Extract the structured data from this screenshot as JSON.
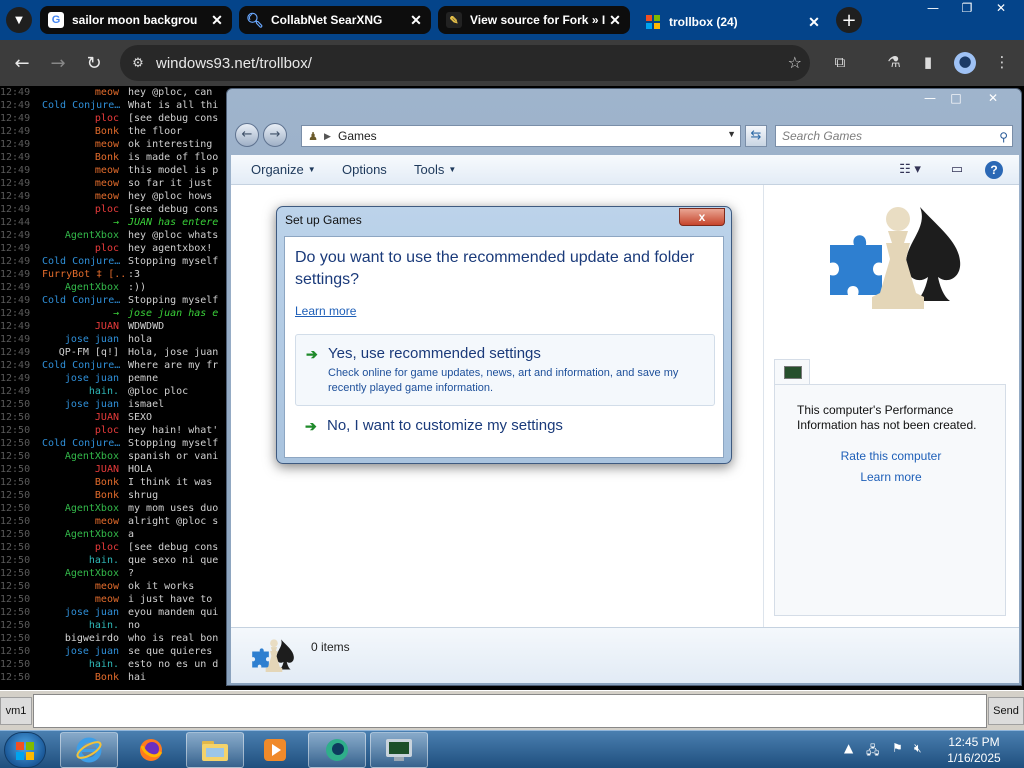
{
  "browser": {
    "tabs": [
      {
        "title": "sailor moon backgrou",
        "favicon": "google-icon"
      },
      {
        "title": "CollabNet SearXNG",
        "favicon": "search-icon"
      },
      {
        "title": "View source for Fork » I",
        "favicon": "wiki-icon"
      },
      {
        "title": "trollbox (24)",
        "favicon": "windows-flag-icon",
        "active": true
      }
    ],
    "url": "windows93.net/trollbox/"
  },
  "chat": {
    "messages": [
      {
        "time": "12:49",
        "nick": "meow",
        "color": "#e36c2c",
        "text": "hey @ploc, can"
      },
      {
        "time": "12:49",
        "nick": "Cold Conjure…",
        "color": "#2f8fd8",
        "text": "What is all thi"
      },
      {
        "time": "12:49",
        "nick": "ploc",
        "color": "#e83b3b",
        "text": "[see debug cons"
      },
      {
        "time": "12:49",
        "nick": "Bonk",
        "color": "#e36c2c",
        "text": "the floor"
      },
      {
        "time": "12:49",
        "nick": "meow",
        "color": "#e36c2c",
        "text": "ok interesting"
      },
      {
        "time": "12:49",
        "nick": "Bonk",
        "color": "#e36c2c",
        "text": "is made of floo"
      },
      {
        "time": "12:49",
        "nick": "meow",
        "color": "#e36c2c",
        "text": "this model is p"
      },
      {
        "time": "12:49",
        "nick": "meow",
        "color": "#e36c2c",
        "text": "so far it just"
      },
      {
        "time": "12:49",
        "nick": "meow",
        "color": "#e36c2c",
        "text": "hey @ploc hows"
      },
      {
        "time": "12:49",
        "nick": "ploc",
        "color": "#e83b3b",
        "text": "[see debug cons"
      },
      {
        "time": "12:44",
        "nick": "→",
        "color": "#3ad23a",
        "text": "JUAN has entere",
        "sys": true
      },
      {
        "time": "12:49",
        "nick": "AgentXbox",
        "color": "#33b84a",
        "text": "hey @ploc whats"
      },
      {
        "time": "12:49",
        "nick": "ploc",
        "color": "#e83b3b",
        "text": "hey agentxbox!"
      },
      {
        "time": "12:49",
        "nick": "Cold Conjure…",
        "color": "#2f8fd8",
        "text": "Stopping myself"
      },
      {
        "time": "12:49",
        "nick": "FurryBot ‡ [..",
        "color": "#e36c2c",
        "text": ":3"
      },
      {
        "time": "12:49",
        "nick": "AgentXbox",
        "color": "#33b84a",
        "text": ":))"
      },
      {
        "time": "12:49",
        "nick": "Cold Conjure…",
        "color": "#2f8fd8",
        "text": "Stopping myself"
      },
      {
        "time": "12:49",
        "nick": "→",
        "color": "#3ad23a",
        "text": "jose juan has e",
        "sys": true
      },
      {
        "time": "12:49",
        "nick": "JUAN",
        "color": "#e83b3b",
        "text": "WDWDWD"
      },
      {
        "time": "12:49",
        "nick": "jose juan",
        "color": "#2f8fd8",
        "text": "hola"
      },
      {
        "time": "12:49",
        "nick": "QP-FM [q!]",
        "color": "#cfcfcf",
        "text": "Hola, jose juan"
      },
      {
        "time": "12:49",
        "nick": "Cold Conjure…",
        "color": "#2f8fd8",
        "text": "Where are my fr"
      },
      {
        "time": "12:49",
        "nick": "jose juan",
        "color": "#2f8fd8",
        "text": "pemne"
      },
      {
        "time": "12:49",
        "nick": "hain.",
        "color": "#2fb8b8",
        "text": "@ploc ploc"
      },
      {
        "time": "12:50",
        "nick": "jose juan",
        "color": "#2f8fd8",
        "text": "ismael"
      },
      {
        "time": "12:50",
        "nick": "JUAN",
        "color": "#e83b3b",
        "text": "SEXO"
      },
      {
        "time": "12:50",
        "nick": "ploc",
        "color": "#e83b3b",
        "text": "hey hain! what'"
      },
      {
        "time": "12:50",
        "nick": "Cold Conjure…",
        "color": "#2f8fd8",
        "text": "Stopping myself"
      },
      {
        "time": "12:50",
        "nick": "AgentXbox",
        "color": "#33b84a",
        "text": "spanish or vani"
      },
      {
        "time": "12:50",
        "nick": "JUAN",
        "color": "#e83b3b",
        "text": "HOLA"
      },
      {
        "time": "12:50",
        "nick": "Bonk",
        "color": "#e36c2c",
        "text": "I think it was"
      },
      {
        "time": "12:50",
        "nick": "Bonk",
        "color": "#e36c2c",
        "text": "shrug"
      },
      {
        "time": "12:50",
        "nick": "AgentXbox",
        "color": "#33b84a",
        "text": "my mom uses duo"
      },
      {
        "time": "12:50",
        "nick": "meow",
        "color": "#e36c2c",
        "text": "alright @ploc s"
      },
      {
        "time": "12:50",
        "nick": "AgentXbox",
        "color": "#33b84a",
        "text": "a"
      },
      {
        "time": "12:50",
        "nick": "ploc",
        "color": "#e83b3b",
        "text": "[see debug cons"
      },
      {
        "time": "12:50",
        "nick": "hain.",
        "color": "#2fb8b8",
        "text": "que sexo ni que"
      },
      {
        "time": "12:50",
        "nick": "AgentXbox",
        "color": "#33b84a",
        "text": "?"
      },
      {
        "time": "12:50",
        "nick": "meow",
        "color": "#e36c2c",
        "text": "ok it works"
      },
      {
        "time": "12:50",
        "nick": "meow",
        "color": "#e36c2c",
        "text": "i just have to"
      },
      {
        "time": "12:50",
        "nick": "jose juan",
        "color": "#2f8fd8",
        "text": "eyou mandem qui"
      },
      {
        "time": "12:50",
        "nick": "hain.",
        "color": "#2fb8b8",
        "text": "no"
      },
      {
        "time": "12:50",
        "nick": "bigweirdo",
        "color": "#d8d8d8",
        "text": "who is real bon"
      },
      {
        "time": "12:50",
        "nick": "jose juan",
        "color": "#2f8fd8",
        "text": "se que quieres"
      },
      {
        "time": "12:50",
        "nick": "hain.",
        "color": "#2fb8b8",
        "text": "esto no es un d"
      },
      {
        "time": "12:50",
        "nick": "Bonk",
        "color": "#e36c2c",
        "text": "hai"
      }
    ],
    "nick_label": "vm1",
    "send_label": "Send",
    "input_value": ""
  },
  "games_window": {
    "address_crumb": "Games",
    "search_placeholder": "Search Games",
    "commands": {
      "organize": "Organize",
      "options": "Options",
      "tools": "Tools"
    },
    "perf_text": "This computer's Performance Information has not been created.",
    "rate_link": "Rate this computer",
    "learn_more_link": "Learn more",
    "items_count": "0 items"
  },
  "dialog": {
    "title": "Set up Games",
    "close_label": "x",
    "question": "Do you want to use the recommended update and folder settings?",
    "learn_more": "Learn more",
    "option_recommended": {
      "label": "Yes, use recommended settings",
      "description": "Check online for game updates, news, art and information, and save my recently played game information."
    },
    "option_custom": {
      "label": "No, I want to customize my settings"
    }
  },
  "taskbar": {
    "time": "12:45 PM",
    "date": "1/16/2025"
  }
}
